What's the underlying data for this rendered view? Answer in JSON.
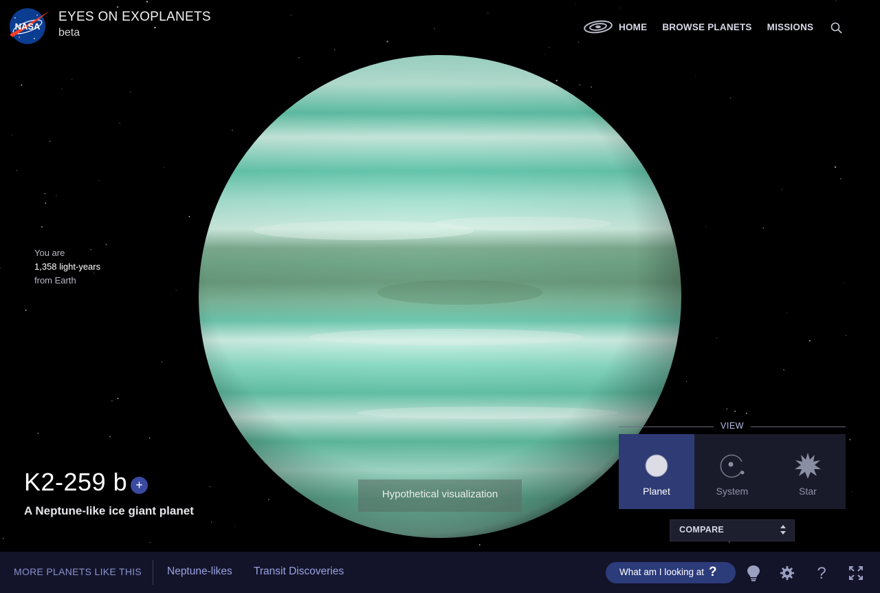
{
  "header": {
    "logo_text": "NASA",
    "app_title": "EYES ON EXOPLANETS",
    "app_subtitle": "beta",
    "nav": [
      {
        "label": "HOME",
        "icon": "galaxy-icon"
      },
      {
        "label": "BROWSE PLANETS"
      },
      {
        "label": "MISSIONS"
      }
    ],
    "search_icon": "search-icon"
  },
  "distance": {
    "line1": "You are",
    "value": "1,358 light-years",
    "line3": "from Earth"
  },
  "planet": {
    "name": "K2-259 b",
    "add_label": "+",
    "tagline": "A Neptune-like ice giant planet",
    "visualization_note": "Hypothetical visualization",
    "colors": {
      "base": "#5fc4a8",
      "band_dark": "#6e8a62",
      "band_light": "#cdeee2",
      "space": "#000000"
    }
  },
  "view_panel": {
    "title": "VIEW",
    "options": [
      {
        "label": "Planet",
        "icon": "planet-icon",
        "active": true
      },
      {
        "label": "System",
        "icon": "system-icon",
        "active": false
      },
      {
        "label": "Star",
        "icon": "star-icon",
        "active": false
      }
    ],
    "compare_label": "COMPARE"
  },
  "bottom_bar": {
    "more_label": "MORE PLANETS LIKE THIS",
    "categories": [
      "Neptune-likes",
      "Transit Discoveries"
    ],
    "what_label": "What am I looking at",
    "what_icon": "?",
    "tools": [
      "lightbulb-icon",
      "gear-icon",
      "help-icon",
      "fullscreen-icon"
    ],
    "accent": "#2c3b7a",
    "bar_color": "#13142a"
  }
}
